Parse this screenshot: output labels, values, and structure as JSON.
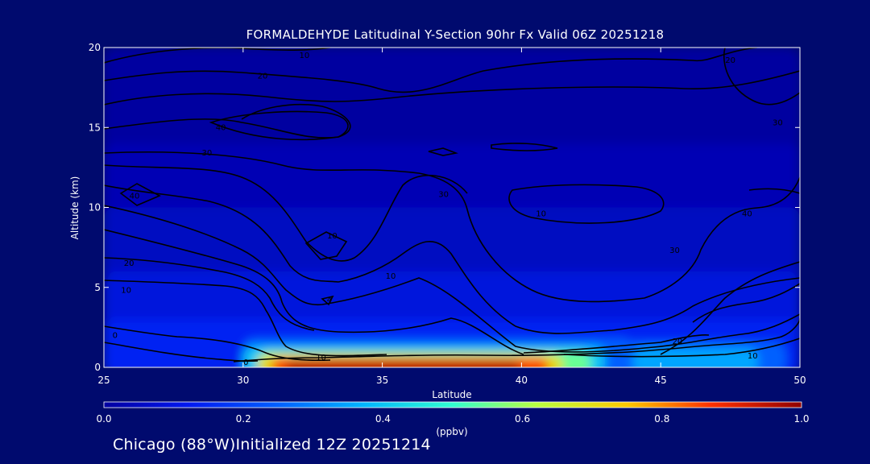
{
  "chart_data": {
    "type": "heatmap",
    "title": "FORMALDEHYDE Latitudinal Y-Section 90hr  Fx Valid 06Z 20251218",
    "xlabel": "Latitude",
    "ylabel": "Altitude (km)",
    "xlim": [
      25,
      50
    ],
    "ylim": [
      0,
      20
    ],
    "x_ticks": [
      "25",
      "30",
      "35",
      "40",
      "45",
      "50"
    ],
    "y_ticks": [
      "0",
      "5",
      "10",
      "15",
      "20"
    ],
    "colorbar": {
      "label": "(ppbv)",
      "range": [
        0.0,
        1.0
      ],
      "ticks": [
        "0.0",
        "0.2",
        "0.4",
        "0.6",
        "0.8",
        "1.0"
      ]
    },
    "grid": false,
    "fields": [
      {
        "lat_range": [
          25,
          50
        ],
        "alt_range": [
          0,
          20
        ],
        "value": 0.0
      },
      {
        "lat_range": [
          25,
          50
        ],
        "alt_range": [
          0,
          14
        ],
        "value": 0.03
      },
      {
        "lat_range": [
          25,
          50
        ],
        "alt_range": [
          0,
          10
        ],
        "value": 0.05
      },
      {
        "lat_range": [
          25,
          50
        ],
        "alt_range": [
          0,
          6
        ],
        "value": 0.09
      },
      {
        "lat_range": [
          25,
          50
        ],
        "alt_range": [
          0,
          3
        ],
        "value": 0.14
      },
      {
        "lat_range": [
          30,
          44
        ],
        "alt_range": [
          0,
          1.8
        ],
        "value": 0.25
      },
      {
        "lat_range": [
          30,
          43
        ],
        "alt_range": [
          0,
          1.3
        ],
        "value": 0.4
      },
      {
        "lat_range": [
          30.5,
          42.5
        ],
        "alt_range": [
          0,
          1.0
        ],
        "value": 0.55
      },
      {
        "lat_range": [
          30.5,
          41.5
        ],
        "alt_range": [
          0,
          0.8
        ],
        "value": 0.7
      },
      {
        "lat_range": [
          31,
          41
        ],
        "alt_range": [
          0,
          0.6
        ],
        "value": 0.85
      },
      {
        "lat_range": [
          31.5,
          40
        ],
        "alt_range": [
          0,
          0.45
        ],
        "value": 0.95
      },
      {
        "lat_range": [
          43,
          49.5
        ],
        "alt_range": [
          0,
          1.6
        ],
        "value": 0.25
      },
      {
        "lat_range": [
          44,
          48.5
        ],
        "alt_range": [
          0,
          1.2
        ],
        "value": 0.35
      }
    ],
    "contour_labels": [
      {
        "text": "10",
        "lat": 32.8,
        "alt": 0.6
      },
      {
        "text": "0",
        "lat": 30.1,
        "alt": 0.3
      },
      {
        "text": "0",
        "lat": 25.4,
        "alt": 2.0
      },
      {
        "text": "10",
        "lat": 25.8,
        "alt": 4.8
      },
      {
        "text": "20",
        "lat": 25.9,
        "alt": 6.5
      },
      {
        "text": "40",
        "lat": 26.1,
        "alt": 10.7
      },
      {
        "text": "30",
        "lat": 28.7,
        "alt": 13.4
      },
      {
        "text": "40",
        "lat": 29.2,
        "alt": 15.0
      },
      {
        "text": "20",
        "lat": 30.7,
        "alt": 18.2
      },
      {
        "text": "10",
        "lat": 32.2,
        "alt": 19.5
      },
      {
        "text": "10",
        "lat": 33.2,
        "alt": 8.2
      },
      {
        "text": "4",
        "lat": 33.1,
        "alt": 4.2
      },
      {
        "text": "10",
        "lat": 35.3,
        "alt": 5.7
      },
      {
        "text": "30",
        "lat": 37.2,
        "alt": 10.8
      },
      {
        "text": "10",
        "lat": 40.7,
        "alt": 9.6
      },
      {
        "text": "30",
        "lat": 45.5,
        "alt": 7.3
      },
      {
        "text": "40",
        "lat": 48.1,
        "alt": 9.6
      },
      {
        "text": "30",
        "lat": 49.2,
        "alt": 15.3
      },
      {
        "text": "20",
        "lat": 47.5,
        "alt": 19.2
      },
      {
        "text": "20",
        "lat": 45.6,
        "alt": 1.6
      },
      {
        "text": "10",
        "lat": 48.3,
        "alt": 0.7
      }
    ]
  },
  "footer": "Chicago (88°W)Initialized 12Z 20251214",
  "colors": {
    "background": "#000a6e",
    "contour": "#000000",
    "text": "#ffffff"
  }
}
